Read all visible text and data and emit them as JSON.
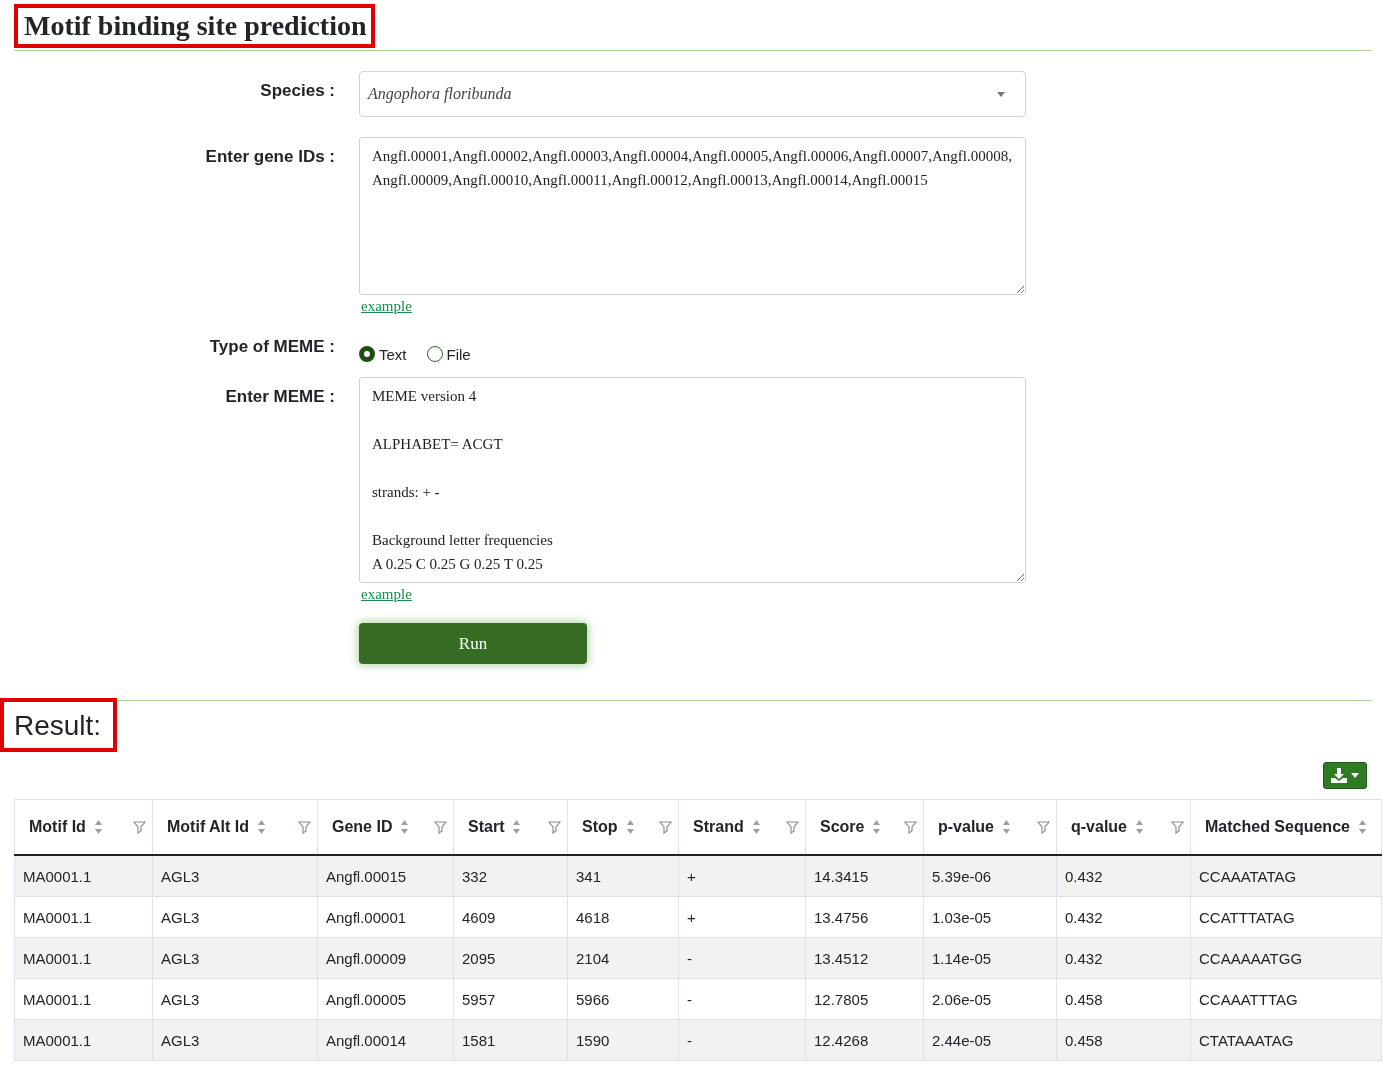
{
  "title": "Motif binding site prediction",
  "form": {
    "species": {
      "label": "Species :",
      "value": "Angophora floribunda"
    },
    "gene_ids": {
      "label": "Enter gene IDs :",
      "value": "Angfl.00001,Angfl.00002,Angfl.00003,Angfl.00004,Angfl.00005,Angfl.00006,Angfl.00007,Angfl.00008,Angfl.00009,Angfl.00010,Angfl.00011,Angfl.00012,Angfl.00013,Angfl.00014,Angfl.00015",
      "link": "example"
    },
    "meme_type": {
      "label": "Type of MEME :",
      "options": [
        {
          "label": "Text",
          "selected": true
        },
        {
          "label": "File",
          "selected": false
        }
      ]
    },
    "meme": {
      "label": "Enter MEME :",
      "paragraphs": [
        [
          "MEME version 4"
        ],
        [
          "ALPHABET= ACGT"
        ],
        [
          "strands: + -"
        ],
        [
          "Background letter frequencies",
          "A 0.25 C 0.25 G 0.25 T 0.25"
        ]
      ],
      "link": "example"
    },
    "run_button": "Run"
  },
  "result": {
    "title": "Result:",
    "table": {
      "columns": [
        "Motif Id",
        "Motif Alt Id",
        "Gene ID",
        "Start",
        "Stop",
        "Strand",
        "Score",
        "p-value",
        "q-value",
        "Matched Sequence"
      ],
      "rows": [
        [
          "MA0001.1",
          "AGL3",
          "Angfl.00015",
          "332",
          "341",
          "+",
          "14.3415",
          "5.39e-06",
          "0.432",
          "CCAAATATAG"
        ],
        [
          "MA0001.1",
          "AGL3",
          "Angfl.00001",
          "4609",
          "4618",
          "+",
          "13.4756",
          "1.03e-05",
          "0.432",
          "CCATTTATAG"
        ],
        [
          "MA0001.1",
          "AGL3",
          "Angfl.00009",
          "2095",
          "2104",
          "-",
          "13.4512",
          "1.14e-05",
          "0.432",
          "CCAAAAATGG"
        ],
        [
          "MA0001.1",
          "AGL3",
          "Angfl.00005",
          "5957",
          "5966",
          "-",
          "12.7805",
          "2.06e-05",
          "0.458",
          "CCAAATTTAG"
        ],
        [
          "MA0001.1",
          "AGL3",
          "Angfl.00014",
          "1581",
          "1590",
          "-",
          "12.4268",
          "2.44e-05",
          "0.458",
          "CTATAAATAG"
        ]
      ]
    }
  }
}
